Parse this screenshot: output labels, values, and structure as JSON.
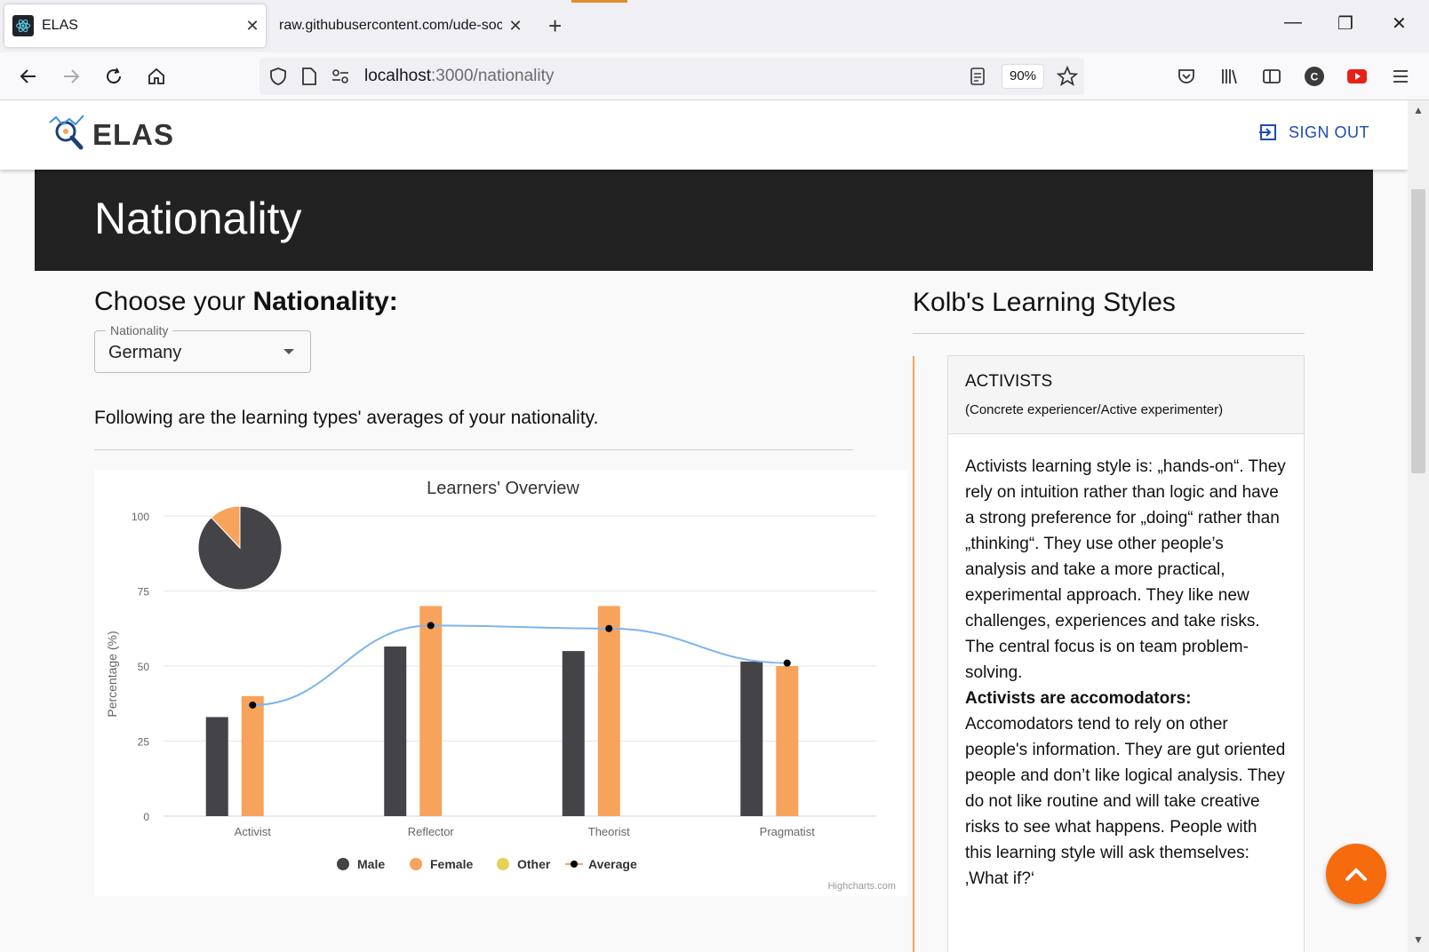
{
  "browser": {
    "tabs": [
      {
        "title": "ELAS",
        "active": true
      },
      {
        "title": "raw.githubusercontent.com/ude-soc",
        "active": false
      }
    ],
    "url_host": "localhost",
    "url_path": ":3000/nationality",
    "zoom": "90%"
  },
  "header": {
    "logo": "ELAS",
    "signout_label": "SIGN OUT"
  },
  "hero": {
    "title": "Nationality"
  },
  "selector": {
    "heading_prefix": "Choose your ",
    "heading_bold": "Nationality:",
    "label": "Nationality",
    "value": "Germany"
  },
  "intro_text": "Following are the learning types' averages of your nationality.",
  "chart_data": {
    "type": "bar",
    "title": "Learners' Overview",
    "ylabel": "Percentage (%)",
    "ylim": [
      0,
      100
    ],
    "yticks": [
      "0",
      "25",
      "50",
      "75",
      "100"
    ],
    "categories": [
      "Activist",
      "Reflector",
      "Theorist",
      "Pragmatist"
    ],
    "series": [
      {
        "name": "Male",
        "type": "bar",
        "color": "#434348",
        "values": [
          33,
          56.5,
          55,
          51.5
        ]
      },
      {
        "name": "Female",
        "type": "bar",
        "color": "#f7a35c",
        "values": [
          40,
          70,
          70,
          50
        ]
      },
      {
        "name": "Other",
        "type": "bar",
        "color": "#e4d354",
        "values": [
          0,
          0,
          0,
          0
        ]
      },
      {
        "name": "Average",
        "type": "line",
        "color": "#7cb5ec",
        "values": [
          37,
          63.5,
          62.5,
          51
        ]
      }
    ],
    "pie": {
      "values": [
        88,
        12
      ],
      "colors": [
        "#434348",
        "#f7a35c"
      ]
    },
    "credits": "Highcharts.com",
    "grid": true,
    "legend": "bottom"
  },
  "kolb": {
    "title": "Kolb's Learning Styles",
    "card_title": "ACTIVISTS",
    "card_subtitle": "(Concrete experiencer/Active experimenter)",
    "para1": "Activists learning style is: „hands-on“. They rely on intuition rather than logic and have a strong preference for „doing“ rather than „thinking“. They use other people’s analysis and take a more practical, experimental approach. They like new challenges, experiences and take risks. The central focus is on team problem-solving.",
    "bold_heading": "Activists are accomodators:",
    "para2": "Accomodators tend to rely on other people's information. They are gut oriented people and don’t like logical analysis. They do not like routine and will take creative risks to see what happens. People with this learning style will ask themselves:",
    "para3": "‚What if?‘"
  }
}
